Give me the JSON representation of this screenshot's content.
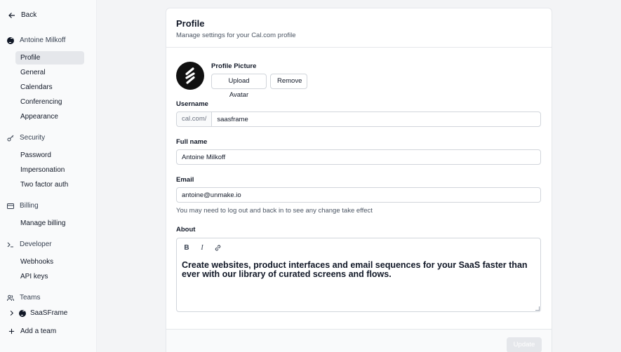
{
  "sidebar": {
    "back_label": "Back",
    "account_name": "Antoine Milkoff",
    "account_items": [
      "Profile",
      "General",
      "Calendars",
      "Conferencing",
      "Appearance"
    ],
    "security_label": "Security",
    "security_items": [
      "Password",
      "Impersonation",
      "Two factor auth"
    ],
    "billing_label": "Billing",
    "billing_items": [
      "Manage billing"
    ],
    "developer_label": "Developer",
    "developer_items": [
      "Webhooks",
      "API keys"
    ],
    "teams_label": "Teams",
    "team_name": "SaaSFrame",
    "add_team_label": "Add a team",
    "active_item": "Profile"
  },
  "profile": {
    "title": "Profile",
    "subtitle": "Manage settings for your Cal.com profile",
    "picture_label": "Profile Picture",
    "upload_label": "Upload Avatar",
    "remove_label": "Remove",
    "username_label": "Username",
    "username_prefix": "cal.com/",
    "username_value": "saasframe",
    "fullname_label": "Full name",
    "fullname_value": "Antoine Milkoff",
    "email_label": "Email",
    "email_value": "antoine@unmake.io",
    "email_hint": "You may need to log out and back in to see any change take effect",
    "about_label": "About",
    "about_value": "Create websites, product interfaces and email sequences for your SaaS faster than ever with our library of curated screens and flows.",
    "update_label": "Update"
  },
  "colors": {
    "active_bg": "#e5e7eb",
    "text": "#111827",
    "muted": "#4b5563"
  }
}
